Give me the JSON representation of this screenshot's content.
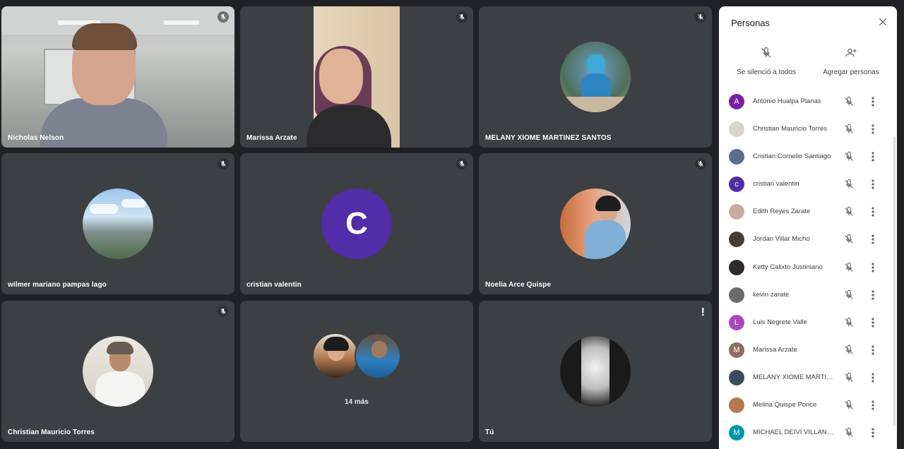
{
  "tiles": [
    {
      "name": "Nicholas Nelson",
      "muted": true
    },
    {
      "name": "Marissa Arzate",
      "muted": true
    },
    {
      "name": "MELANY XIOME MARTINEZ SANTOS",
      "muted": true
    },
    {
      "name": "wilmer mariano pampas lago",
      "muted": true
    },
    {
      "name": "cristian valentin",
      "muted": true,
      "avatar_letter": "C"
    },
    {
      "name": "Noelia Arce Quispe",
      "muted": true
    },
    {
      "name": "Christian Mauricio Torres",
      "muted": true
    },
    {
      "more_label": "14 más"
    },
    {
      "name": "Tú",
      "alert": "!"
    }
  ],
  "panel": {
    "title": "Personas",
    "mute_all_label": "Se silenció a todos",
    "add_people_label": "Agregar personas",
    "participants": [
      {
        "name": "Antonio Hualpa Planas",
        "letter": "A",
        "color": "#7b1fa2"
      },
      {
        "name": "Christian Mauricio Torres",
        "color": "#d9d4cc"
      },
      {
        "name": "Cristian Cornelio Santiago",
        "color": "#5a6c8f"
      },
      {
        "name": "cristian valentin",
        "letter": "c",
        "color": "#512da8"
      },
      {
        "name": "Edith Reyes Zarate",
        "color": "#c9a9a0"
      },
      {
        "name": "Jordan Villar Micho",
        "color": "#4a3b35"
      },
      {
        "name": "Ketty Calixto Justiniano",
        "color": "#2f2a2a"
      },
      {
        "name": "kevin zarate",
        "color": "#6b6b6b"
      },
      {
        "name": "Luis Negrete Valle",
        "letter": "L",
        "color": "#ab47bc"
      },
      {
        "name": "Marissa Arzate",
        "letter": "M",
        "color": "#8d6e63"
      },
      {
        "name": "MELANY XIOME MARTIN...",
        "color": "#3a4a5a"
      },
      {
        "name": "Melina Quispe Ponce",
        "color": "#b5774f"
      },
      {
        "name": "MICHAEL DEIVI VILLANUE...",
        "letter": "M",
        "color": "#0097a7"
      }
    ]
  }
}
